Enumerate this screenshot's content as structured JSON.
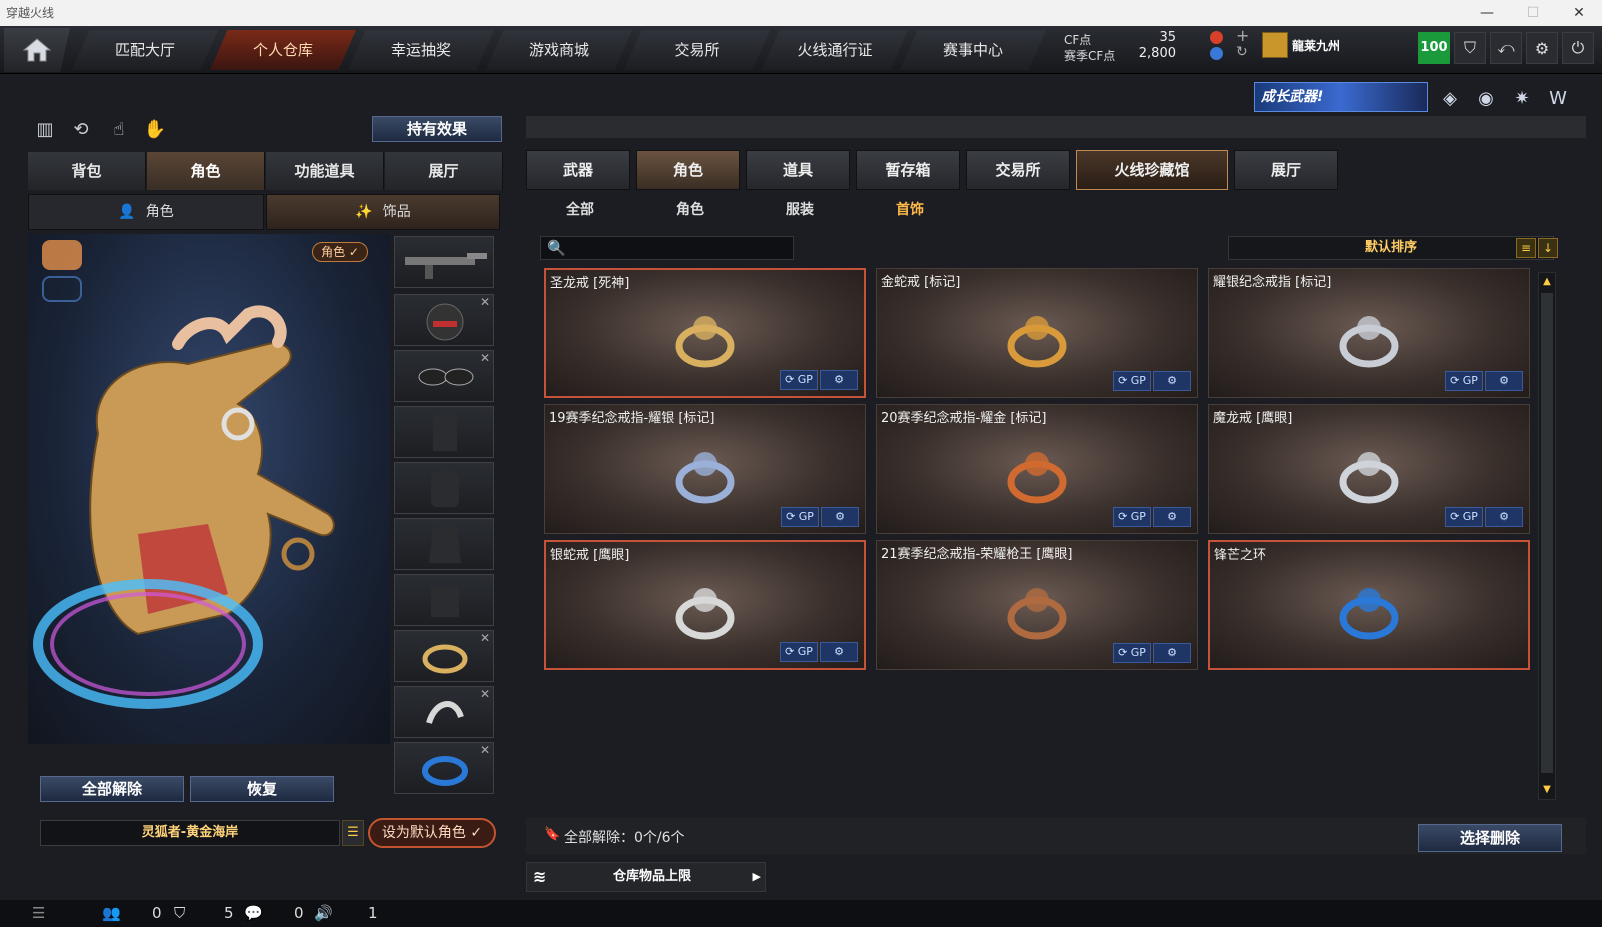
{
  "window": {
    "title": "穿越火线"
  },
  "nav": {
    "tabs": [
      {
        "label": "匹配大厅",
        "active": false
      },
      {
        "label": "个人仓库",
        "active": true
      },
      {
        "label": "幸运抽奖",
        "active": false
      },
      {
        "label": "游戏商城",
        "active": false
      },
      {
        "label": "交易所",
        "active": false
      },
      {
        "label": "火线通行证",
        "active": false
      },
      {
        "label": "赛事中心",
        "active": false
      }
    ],
    "cf_point_label": "CF点",
    "season_cf_label": "赛季CF点",
    "cf_point_value": "35",
    "season_cf_value": "2,800",
    "username": "龍莱九州",
    "level": "100"
  },
  "banner": {
    "text": "成长武器!"
  },
  "left": {
    "effect_button": "持有效果",
    "tabs": [
      {
        "label": "背包",
        "active": false
      },
      {
        "label": "角色",
        "active": true
      },
      {
        "label": "功能道具",
        "active": false
      },
      {
        "label": "展厅",
        "active": false
      }
    ],
    "subtabs": [
      {
        "label": "角色",
        "active": false
      },
      {
        "label": "饰品",
        "active": true
      }
    ],
    "role_pill": "角色 ✓",
    "release_all": "全部解除",
    "restore": "恢复",
    "character_name": "灵狐者-黄金海岸",
    "set_default": "设为默认角色 ✓"
  },
  "right": {
    "tabs": [
      {
        "label": "武器",
        "active": false
      },
      {
        "label": "角色",
        "active": true
      },
      {
        "label": "道具",
        "active": false
      },
      {
        "label": "暂存箱",
        "active": false
      },
      {
        "label": "交易所",
        "active": false
      },
      {
        "label": "火线珍藏馆",
        "active": false
      },
      {
        "label": "展厅",
        "active": false
      }
    ],
    "subtabs": [
      {
        "label": "全部",
        "active": false
      },
      {
        "label": "角色",
        "active": false
      },
      {
        "label": "服装",
        "active": false
      },
      {
        "label": "首饰",
        "active": true
      }
    ],
    "search_placeholder": "",
    "sort_label": "默认排序",
    "items": [
      {
        "name": "圣龙戒 [死神]",
        "color": "#d8b060",
        "highlight": true
      },
      {
        "name": "金蛇戒 [标记]",
        "color": "#d89a3a",
        "highlight": false
      },
      {
        "name": "耀银纪念戒指 [标记]",
        "color": "#c8ccd4",
        "highlight": false
      },
      {
        "name": "19赛季纪念戒指-耀银 [标记]",
        "color": "#9ab0d8",
        "highlight": false
      },
      {
        "name": "20赛季纪念戒指-耀金 [标记]",
        "color": "#d06a30",
        "highlight": false
      },
      {
        "name": "魔龙戒 [鹰眼]",
        "color": "#cfd3da",
        "highlight": false
      },
      {
        "name": "银蛇戒 [鹰眼]",
        "color": "#d8d8d8",
        "highlight": true
      },
      {
        "name": "21赛季纪念戒指-荣耀枪王 [鹰眼]",
        "color": "#b06a40",
        "highlight": false
      },
      {
        "name": "锋芒之环",
        "color": "#2a78d8",
        "highlight": true
      }
    ],
    "status_text": "全部解除：0个/6个",
    "delete_button": "选择删除",
    "storage_label": "仓库物品上限"
  },
  "footer": {
    "friends": "0",
    "clan": "5",
    "chat": "0",
    "volume": "1"
  }
}
